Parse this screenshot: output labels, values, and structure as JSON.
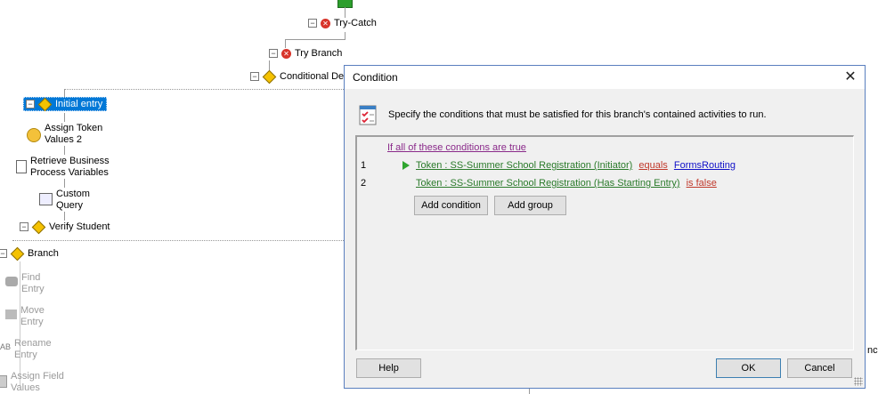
{
  "workflow": {
    "try_catch": "Try-Catch",
    "try_branch": "Try Branch",
    "conditional": "Conditional Dec",
    "initial_entry": "Initial entry",
    "assign_token_1": "Assign Token",
    "assign_token_2": "Values 2",
    "retrieve_1": "Retrieve Business",
    "retrieve_2": "Process Variables",
    "custom_1": "Custom",
    "custom_2": "Query",
    "verify_student": "Verify Student",
    "branch": "Branch",
    "find_1": "Find",
    "find_2": "Entry",
    "move_1": "Move",
    "move_2": "Entry",
    "rename_1": "Rename",
    "rename_2": "Entry",
    "assign_field_1": "Assign Field",
    "assign_field_2": "Values",
    "right_edge_text": "nch"
  },
  "dialog": {
    "title": "Condition",
    "close_glyph": "✕",
    "description": "Specify the conditions that must be satisfied for this branch's contained activities to run.",
    "header_link": "If all of these conditions are true",
    "conditions": [
      {
        "num": "1",
        "field": "Token : SS-Summer School Registration (Initiator)",
        "op": "equals",
        "value": "FormsRouting"
      },
      {
        "num": "2",
        "field": "Token : SS-Summer School Registration (Has Starting Entry)",
        "op": "is false",
        "value": ""
      }
    ],
    "add_condition": "Add condition",
    "add_group": "Add group",
    "help": "Help",
    "ok": "OK",
    "cancel": "Cancel"
  },
  "colors": {
    "selection": "#0078d7",
    "field_link": "#2a7a2a",
    "op_link": "#c0392b",
    "value_link": "#1010c8",
    "header_link": "#8a2a8a"
  }
}
